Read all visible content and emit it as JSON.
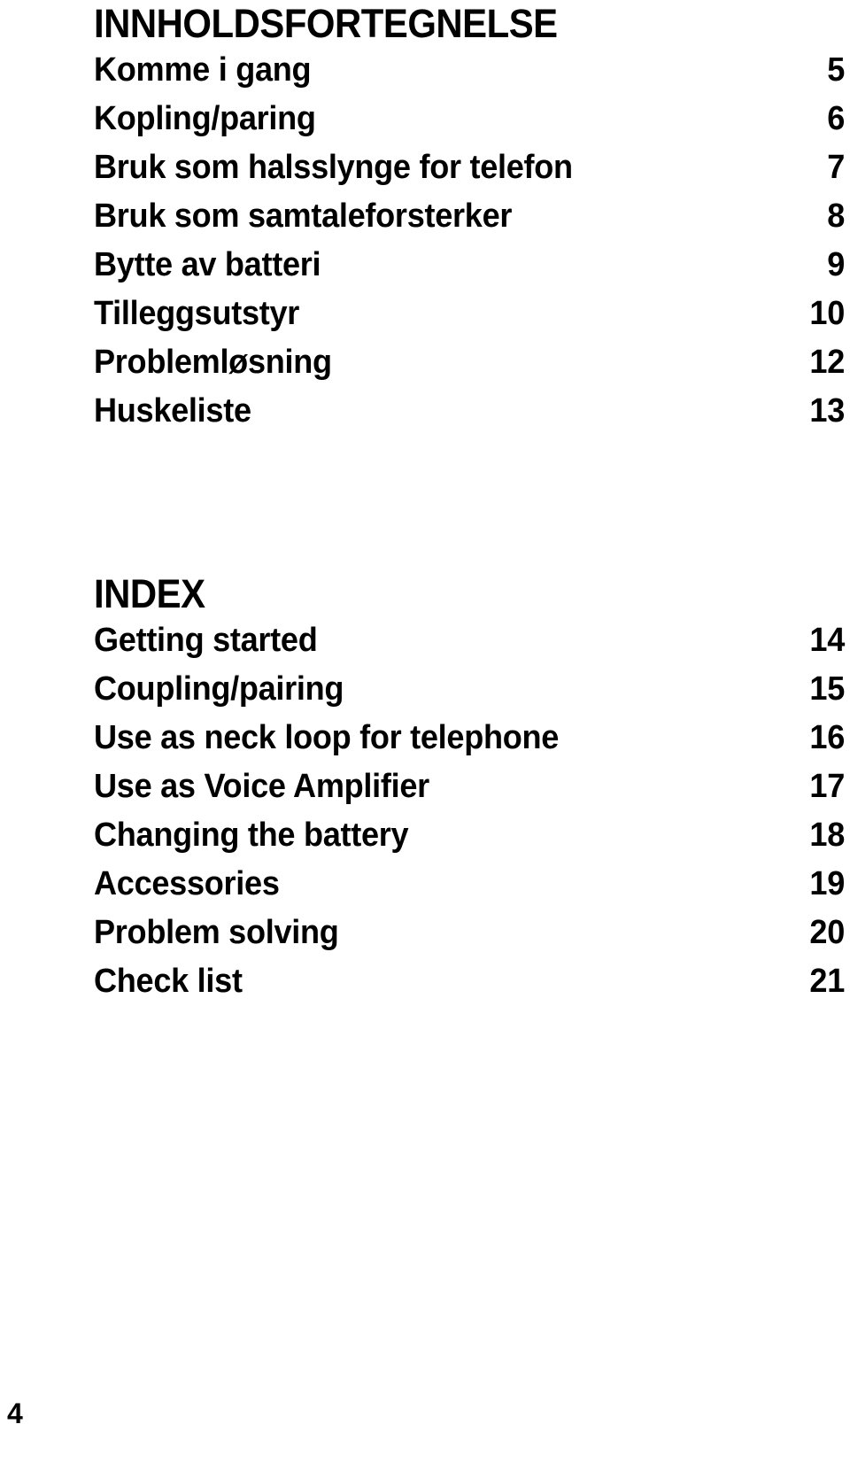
{
  "document": {
    "folio": "4"
  },
  "toc_section": {
    "heading": "INNHOLDSFORTEGNELSE",
    "entries": [
      {
        "label": "Komme i gang",
        "page": "5"
      },
      {
        "label": "Kopling/paring",
        "page": "6"
      },
      {
        "label": "Bruk som halsslynge for telefon",
        "page": "7"
      },
      {
        "label": "Bruk som samtaleforsterker",
        "page": "8"
      },
      {
        "label": "Bytte av batteri",
        "page": "9"
      },
      {
        "label": "Tilleggsutstyr",
        "page": "10"
      },
      {
        "label": "Problemløsning",
        "page": "12"
      },
      {
        "label": "Huskeliste",
        "page": "13"
      }
    ]
  },
  "index_section": {
    "heading": "INDEX",
    "entries": [
      {
        "label": "Getting started",
        "page": "14"
      },
      {
        "label": "Coupling/pairing",
        "page": "15"
      },
      {
        "label": "Use as neck loop for telephone",
        "page": "16"
      },
      {
        "label": "Use as Voice Amplifier",
        "page": "17"
      },
      {
        "label": "Changing the battery",
        "page": "18"
      },
      {
        "label": "Accessories",
        "page": "19"
      },
      {
        "label": "Problem solving",
        "page": "20"
      },
      {
        "label": "Check list",
        "page": "21"
      }
    ]
  }
}
